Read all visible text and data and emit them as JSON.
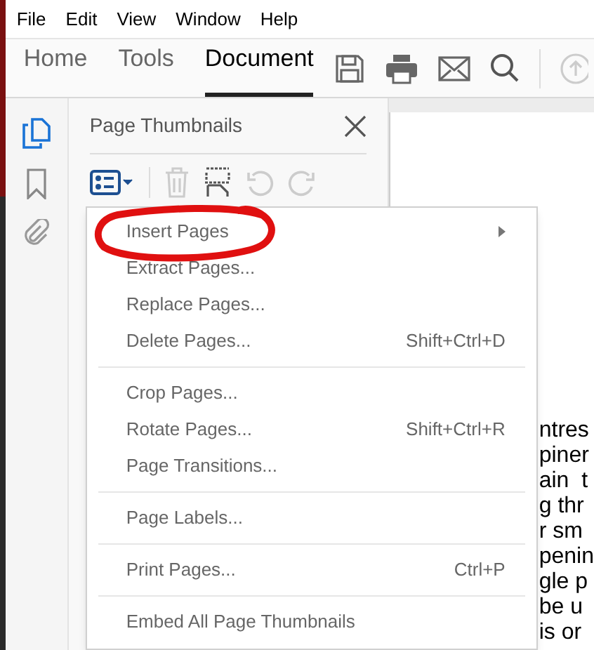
{
  "menu_bar": [
    "File",
    "Edit",
    "View",
    "Window",
    "Help"
  ],
  "tabs": [
    {
      "label": "Home",
      "selected": false
    },
    {
      "label": "Tools",
      "selected": false
    },
    {
      "label": "Document",
      "selected": true
    }
  ],
  "panel": {
    "title": "Page Thumbnails"
  },
  "context_menu": [
    {
      "kind": "submenu",
      "label": "Insert Pages"
    },
    {
      "kind": "item",
      "label": "Extract Pages..."
    },
    {
      "kind": "item",
      "label": "Replace Pages..."
    },
    {
      "kind": "item",
      "label": "Delete Pages...",
      "shortcut": "Shift+Ctrl+D"
    },
    {
      "kind": "separator"
    },
    {
      "kind": "item",
      "label": "Crop Pages..."
    },
    {
      "kind": "item",
      "label": "Rotate Pages...",
      "shortcut": "Shift+Ctrl+R"
    },
    {
      "kind": "item",
      "label": "Page Transitions..."
    },
    {
      "kind": "separator"
    },
    {
      "kind": "item",
      "label": "Page Labels..."
    },
    {
      "kind": "separator"
    },
    {
      "kind": "item",
      "label": "Print Pages...",
      "shortcut": "Ctrl+P"
    },
    {
      "kind": "separator"
    },
    {
      "kind": "item",
      "label": "Embed All Page Thumbnails"
    }
  ],
  "document_lines": [
    "ntres",
    "piner",
    "ain  t",
    "g thr",
    "r sm",
    "penin",
    "gle p",
    "be u",
    "is or"
  ]
}
